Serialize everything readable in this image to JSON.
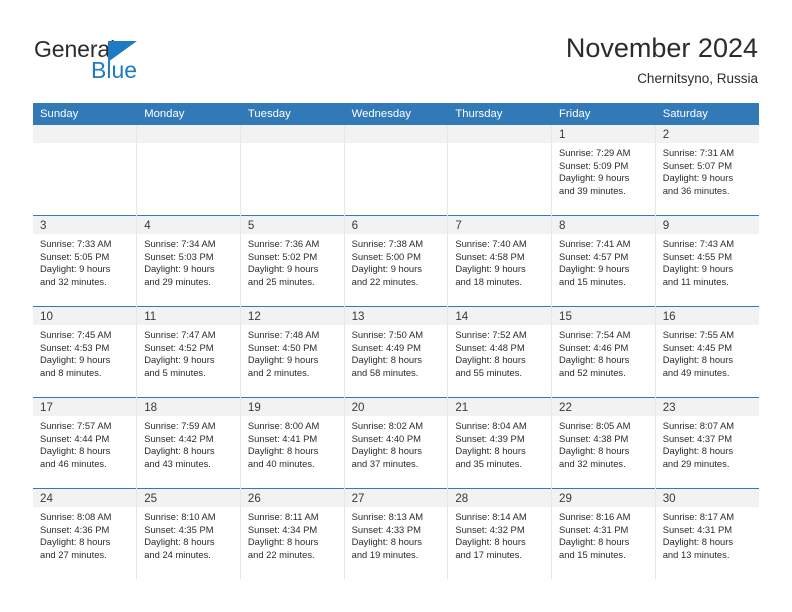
{
  "brand": {
    "name_part1": "General",
    "name_part2": "Blue",
    "accent_color": "#1f7ac4"
  },
  "header": {
    "title": "November 2024",
    "subtitle": "Chernitsyno, Russia"
  },
  "theme": {
    "header_blue": "#3279b7",
    "daynum_band": "#f2f2f2",
    "text": "#2b2b2b"
  },
  "weekday_headers": [
    "Sunday",
    "Monday",
    "Tuesday",
    "Wednesday",
    "Thursday",
    "Friday",
    "Saturday"
  ],
  "weeks": [
    [
      {
        "day": "",
        "empty": true,
        "sunrise": "",
        "sunset": "",
        "daylight1": "",
        "daylight2": ""
      },
      {
        "day": "",
        "empty": true,
        "sunrise": "",
        "sunset": "",
        "daylight1": "",
        "daylight2": ""
      },
      {
        "day": "",
        "empty": true,
        "sunrise": "",
        "sunset": "",
        "daylight1": "",
        "daylight2": ""
      },
      {
        "day": "",
        "empty": true,
        "sunrise": "",
        "sunset": "",
        "daylight1": "",
        "daylight2": ""
      },
      {
        "day": "",
        "empty": true,
        "sunrise": "",
        "sunset": "",
        "daylight1": "",
        "daylight2": ""
      },
      {
        "day": "1",
        "sunrise": "Sunrise: 7:29 AM",
        "sunset": "Sunset: 5:09 PM",
        "daylight1": "Daylight: 9 hours",
        "daylight2": "and 39 minutes."
      },
      {
        "day": "2",
        "sunrise": "Sunrise: 7:31 AM",
        "sunset": "Sunset: 5:07 PM",
        "daylight1": "Daylight: 9 hours",
        "daylight2": "and 36 minutes."
      }
    ],
    [
      {
        "day": "3",
        "sunrise": "Sunrise: 7:33 AM",
        "sunset": "Sunset: 5:05 PM",
        "daylight1": "Daylight: 9 hours",
        "daylight2": "and 32 minutes."
      },
      {
        "day": "4",
        "sunrise": "Sunrise: 7:34 AM",
        "sunset": "Sunset: 5:03 PM",
        "daylight1": "Daylight: 9 hours",
        "daylight2": "and 29 minutes."
      },
      {
        "day": "5",
        "sunrise": "Sunrise: 7:36 AM",
        "sunset": "Sunset: 5:02 PM",
        "daylight1": "Daylight: 9 hours",
        "daylight2": "and 25 minutes."
      },
      {
        "day": "6",
        "sunrise": "Sunrise: 7:38 AM",
        "sunset": "Sunset: 5:00 PM",
        "daylight1": "Daylight: 9 hours",
        "daylight2": "and 22 minutes."
      },
      {
        "day": "7",
        "sunrise": "Sunrise: 7:40 AM",
        "sunset": "Sunset: 4:58 PM",
        "daylight1": "Daylight: 9 hours",
        "daylight2": "and 18 minutes."
      },
      {
        "day": "8",
        "sunrise": "Sunrise: 7:41 AM",
        "sunset": "Sunset: 4:57 PM",
        "daylight1": "Daylight: 9 hours",
        "daylight2": "and 15 minutes."
      },
      {
        "day": "9",
        "sunrise": "Sunrise: 7:43 AM",
        "sunset": "Sunset: 4:55 PM",
        "daylight1": "Daylight: 9 hours",
        "daylight2": "and 11 minutes."
      }
    ],
    [
      {
        "day": "10",
        "sunrise": "Sunrise: 7:45 AM",
        "sunset": "Sunset: 4:53 PM",
        "daylight1": "Daylight: 9 hours",
        "daylight2": "and 8 minutes."
      },
      {
        "day": "11",
        "sunrise": "Sunrise: 7:47 AM",
        "sunset": "Sunset: 4:52 PM",
        "daylight1": "Daylight: 9 hours",
        "daylight2": "and 5 minutes."
      },
      {
        "day": "12",
        "sunrise": "Sunrise: 7:48 AM",
        "sunset": "Sunset: 4:50 PM",
        "daylight1": "Daylight: 9 hours",
        "daylight2": "and 2 minutes."
      },
      {
        "day": "13",
        "sunrise": "Sunrise: 7:50 AM",
        "sunset": "Sunset: 4:49 PM",
        "daylight1": "Daylight: 8 hours",
        "daylight2": "and 58 minutes."
      },
      {
        "day": "14",
        "sunrise": "Sunrise: 7:52 AM",
        "sunset": "Sunset: 4:48 PM",
        "daylight1": "Daylight: 8 hours",
        "daylight2": "and 55 minutes."
      },
      {
        "day": "15",
        "sunrise": "Sunrise: 7:54 AM",
        "sunset": "Sunset: 4:46 PM",
        "daylight1": "Daylight: 8 hours",
        "daylight2": "and 52 minutes."
      },
      {
        "day": "16",
        "sunrise": "Sunrise: 7:55 AM",
        "sunset": "Sunset: 4:45 PM",
        "daylight1": "Daylight: 8 hours",
        "daylight2": "and 49 minutes."
      }
    ],
    [
      {
        "day": "17",
        "sunrise": "Sunrise: 7:57 AM",
        "sunset": "Sunset: 4:44 PM",
        "daylight1": "Daylight: 8 hours",
        "daylight2": "and 46 minutes."
      },
      {
        "day": "18",
        "sunrise": "Sunrise: 7:59 AM",
        "sunset": "Sunset: 4:42 PM",
        "daylight1": "Daylight: 8 hours",
        "daylight2": "and 43 minutes."
      },
      {
        "day": "19",
        "sunrise": "Sunrise: 8:00 AM",
        "sunset": "Sunset: 4:41 PM",
        "daylight1": "Daylight: 8 hours",
        "daylight2": "and 40 minutes."
      },
      {
        "day": "20",
        "sunrise": "Sunrise: 8:02 AM",
        "sunset": "Sunset: 4:40 PM",
        "daylight1": "Daylight: 8 hours",
        "daylight2": "and 37 minutes."
      },
      {
        "day": "21",
        "sunrise": "Sunrise: 8:04 AM",
        "sunset": "Sunset: 4:39 PM",
        "daylight1": "Daylight: 8 hours",
        "daylight2": "and 35 minutes."
      },
      {
        "day": "22",
        "sunrise": "Sunrise: 8:05 AM",
        "sunset": "Sunset: 4:38 PM",
        "daylight1": "Daylight: 8 hours",
        "daylight2": "and 32 minutes."
      },
      {
        "day": "23",
        "sunrise": "Sunrise: 8:07 AM",
        "sunset": "Sunset: 4:37 PM",
        "daylight1": "Daylight: 8 hours",
        "daylight2": "and 29 minutes."
      }
    ],
    [
      {
        "day": "24",
        "sunrise": "Sunrise: 8:08 AM",
        "sunset": "Sunset: 4:36 PM",
        "daylight1": "Daylight: 8 hours",
        "daylight2": "and 27 minutes."
      },
      {
        "day": "25",
        "sunrise": "Sunrise: 8:10 AM",
        "sunset": "Sunset: 4:35 PM",
        "daylight1": "Daylight: 8 hours",
        "daylight2": "and 24 minutes."
      },
      {
        "day": "26",
        "sunrise": "Sunrise: 8:11 AM",
        "sunset": "Sunset: 4:34 PM",
        "daylight1": "Daylight: 8 hours",
        "daylight2": "and 22 minutes."
      },
      {
        "day": "27",
        "sunrise": "Sunrise: 8:13 AM",
        "sunset": "Sunset: 4:33 PM",
        "daylight1": "Daylight: 8 hours",
        "daylight2": "and 19 minutes."
      },
      {
        "day": "28",
        "sunrise": "Sunrise: 8:14 AM",
        "sunset": "Sunset: 4:32 PM",
        "daylight1": "Daylight: 8 hours",
        "daylight2": "and 17 minutes."
      },
      {
        "day": "29",
        "sunrise": "Sunrise: 8:16 AM",
        "sunset": "Sunset: 4:31 PM",
        "daylight1": "Daylight: 8 hours",
        "daylight2": "and 15 minutes."
      },
      {
        "day": "30",
        "sunrise": "Sunrise: 8:17 AM",
        "sunset": "Sunset: 4:31 PM",
        "daylight1": "Daylight: 8 hours",
        "daylight2": "and 13 minutes."
      }
    ]
  ]
}
